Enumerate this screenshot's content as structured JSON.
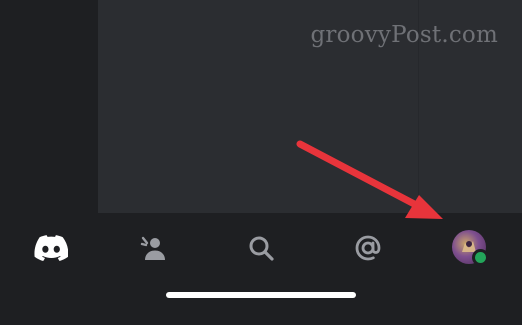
{
  "watermark": {
    "text": "groovyPost.com"
  },
  "bottom_nav": {
    "items": [
      {
        "id": "home",
        "icon": "discord-logo-icon",
        "active": true
      },
      {
        "id": "friends",
        "icon": "friends-wave-icon",
        "active": false
      },
      {
        "id": "search",
        "icon": "search-icon",
        "active": false
      },
      {
        "id": "mentions",
        "icon": "at-sign-icon",
        "active": false
      },
      {
        "id": "profile",
        "icon": "user-avatar",
        "active": false,
        "status": "online"
      }
    ]
  },
  "annotation": {
    "type": "arrow",
    "color": "#e8343b",
    "points_to": "profile"
  },
  "colors": {
    "background": "#1e1f22",
    "panel": "#2b2d31",
    "icon_active": "#ffffff",
    "icon_inactive": "#9a9ca2",
    "status_online": "#23a55a",
    "arrow": "#e8343b"
  }
}
